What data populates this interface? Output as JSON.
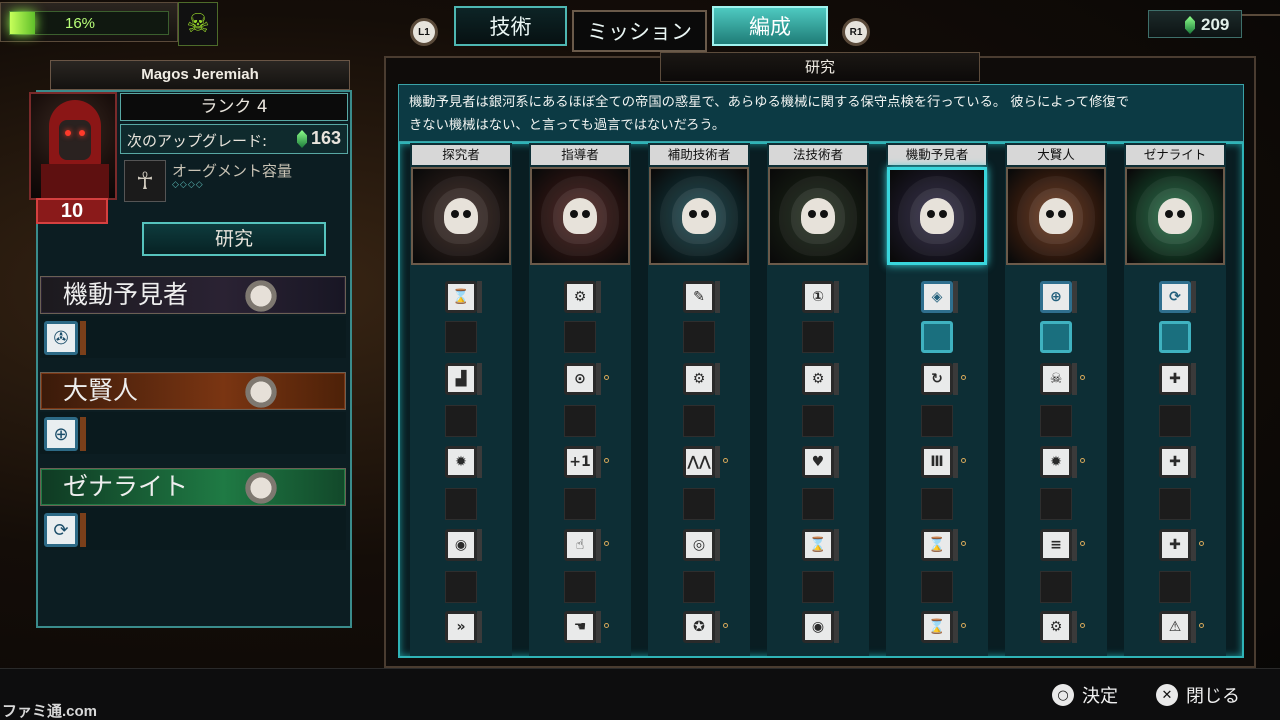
{
  "hud": {
    "energy_text": "16%",
    "energy_fraction": 0.16,
    "skull_badge_icon": "cog-skull-icon",
    "gems_value": "209",
    "gem_icon": "green-gem-icon"
  },
  "tabs": {
    "l1": "L1",
    "r1": "R1",
    "items": [
      {
        "label": "技術",
        "active": false
      },
      {
        "label": "ミッション",
        "active": false
      },
      {
        "label": "編成",
        "active": true
      }
    ]
  },
  "character": {
    "name": "Magos Jeremiah",
    "level": "10",
    "rank": "ランク 4",
    "upgrade_label": "次のアップグレード:",
    "upgrade_value": "163",
    "augment_label": "オーグメント容量",
    "augment_pips": "◇◇◇◇",
    "research_button": "研究"
  },
  "specializations": [
    {
      "name": "機動予見者",
      "color": "#2a2233",
      "skill_icon": "droplet-gear-icon"
    },
    {
      "name": "大賢人",
      "color": "#7a3512",
      "skill_icon": "crosshair-gear-icon"
    },
    {
      "name": "ゼナライト",
      "color": "#1f7a44",
      "skill_icon": "rotate-gear-icon"
    }
  ],
  "research": {
    "title": "研究",
    "description_line1": "機動予見者は銀河系にあるほぼ全ての帝国の惑星で、あらゆる機械に関する保守点検を行っている。 彼らによって修復で",
    "description_line2": "きない機械はない、と言っても過言ではないだろう。",
    "columns": [
      {
        "name": "探究者",
        "emblem_color": "#3a2620",
        "selected": false
      },
      {
        "name": "指導者",
        "emblem_color": "#4a1c18",
        "selected": false
      },
      {
        "name": "補助技術者",
        "emblem_color": "#12444c",
        "selected": false
      },
      {
        "name": "法技術者",
        "emblem_color": "#1d2a18",
        "selected": false
      },
      {
        "name": "機動予見者",
        "emblem_color": "#2a2442",
        "selected": true
      },
      {
        "name": "大賢人",
        "emblem_color": "#6a2f12",
        "selected": false
      },
      {
        "name": "ゼナライト",
        "emblem_color": "#1a6a3e",
        "selected": false
      }
    ]
  },
  "prompts": {
    "decide_icon": "○",
    "decide_label": "決定",
    "close_icon": "✕",
    "close_label": "閉じる"
  },
  "watermark": "ファミ通.com"
}
